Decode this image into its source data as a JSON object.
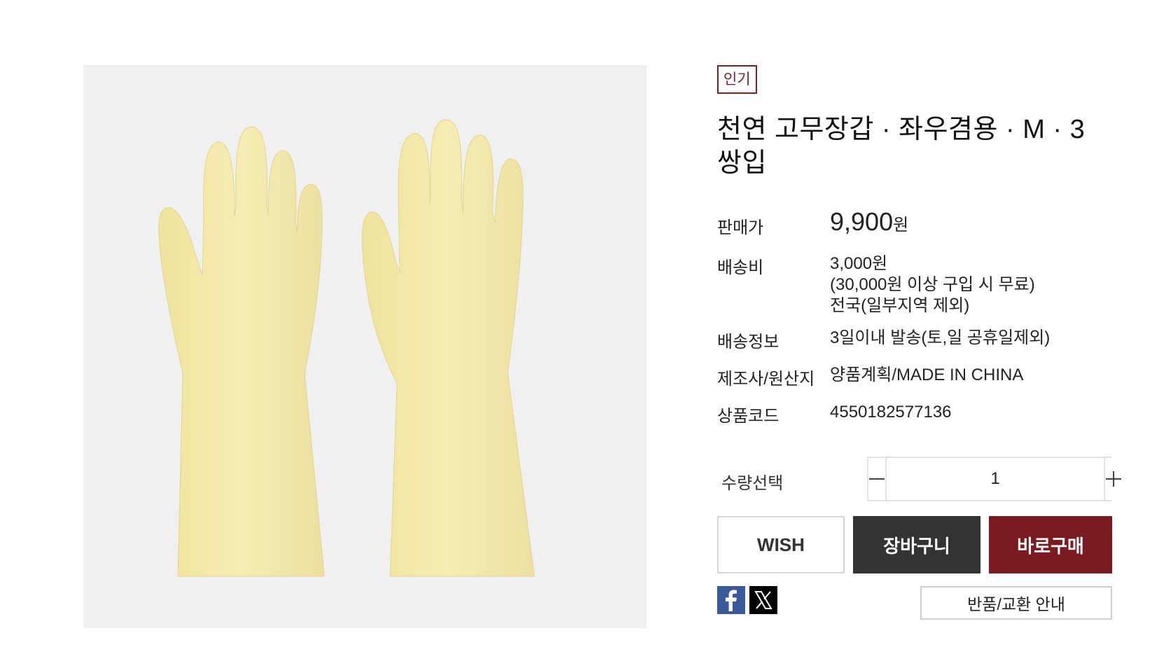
{
  "product": {
    "badge": "인기",
    "title": "천연 고무장갑 · 좌우겸용 · M  · 3쌍입",
    "image_alt": "yellow-rubber-gloves"
  },
  "specs": {
    "price_label": "판매가",
    "price_value": "9,900",
    "price_unit": "원",
    "shipping_label": "배송비",
    "shipping_fee": "3,000원",
    "shipping_free": "(30,000원 이상 구입 시 무료)",
    "shipping_area": "전국(일부지역 제외)",
    "delivery_label": "배송정보",
    "delivery_value": "3일이내 발송(토,일 공휴일제외)",
    "maker_label": "제조사/원산지",
    "maker_value": "양품계획/MADE IN CHINA",
    "code_label": "상품코드",
    "code_value": "4550182577136"
  },
  "quantity": {
    "label": "수량선택",
    "value": "1",
    "minus": "−",
    "plus": "+"
  },
  "actions": {
    "wish": "WISH",
    "cart": "장바구니",
    "buy": "바로구매",
    "return_info": "반품/교환 안내"
  },
  "share": {
    "facebook_icon": "facebook-icon",
    "x_icon": "x-icon"
  },
  "colors": {
    "accent": "#7a1a21",
    "cart": "#333333",
    "glove": "#f3e7a3"
  }
}
